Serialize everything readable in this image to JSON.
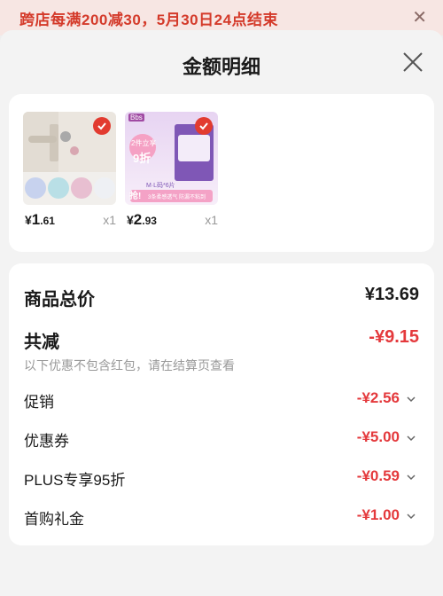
{
  "banner": {
    "text": "跨店每满200减30，5月30日24点结束",
    "close_icon": "close-icon"
  },
  "sheet": {
    "title": "金额明细",
    "close_icon": "close-icon"
  },
  "products": [
    {
      "price_currency": "¥",
      "price_int": "1",
      "price_dec": ".61",
      "quantity": "x1",
      "selected": true
    },
    {
      "price_currency": "¥",
      "price_int": "2",
      "price_dec": ".93",
      "quantity": "x1",
      "selected": true,
      "image_text": {
        "brand": "Bbs",
        "badge": "2件立享",
        "discount": "9折",
        "grab": "抢!",
        "size": "M·L码*6片",
        "tagline": "3条柔感透气 防漏不粘到"
      }
    }
  ],
  "summary": {
    "total_label": "商品总价",
    "total_value": "¥13.69",
    "reduce_label": "共减",
    "reduce_value": "-¥9.15",
    "note": "以下优惠不包含红包，请在结算页查看"
  },
  "details": [
    {
      "label": "促销",
      "value": "-¥2.56"
    },
    {
      "label": "优惠券",
      "value": "-¥5.00"
    },
    {
      "label": "PLUS专享95折",
      "value": "-¥0.59"
    },
    {
      "label": "首购礼金",
      "value": "-¥1.00"
    }
  ],
  "colors": {
    "accent_red": "#e4393c",
    "banner_bg": "#f7e6e3",
    "banner_text": "#d43a2a"
  }
}
